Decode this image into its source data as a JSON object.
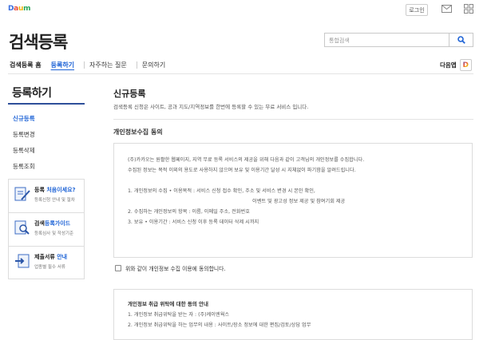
{
  "logo": "Daum",
  "topbar": {
    "login": "로그인"
  },
  "header": {
    "title": "검색등록",
    "search_placeholder": "통합검색"
  },
  "nav": {
    "home": "검색등록 홈",
    "active": "등록하기",
    "faq": "자주하는 질문",
    "contact": "문의하기",
    "right_label": "다음앱",
    "right_badge": "D"
  },
  "sidebar": {
    "title": "등록하기",
    "items": [
      {
        "label": "신규등록",
        "active": true
      },
      {
        "label": "등록변경"
      },
      {
        "label": "등록삭제"
      },
      {
        "label": "등록조회"
      }
    ],
    "promos": [
      {
        "title_plain": "등록 ",
        "title_hl": "처음이세요?",
        "sub": "등록신청 안내 및 절차",
        "icon": "pencil-doc-icon"
      },
      {
        "title_plain": "검색",
        "title_hl": "등록가이드",
        "sub": "등록심사 및 작성기준",
        "icon": "magnifier-doc-icon"
      },
      {
        "title_plain": "제출서류 ",
        "title_hl": "안내",
        "sub": "업종별 필수 서류",
        "icon": "arrow-doc-icon"
      }
    ]
  },
  "main": {
    "title": "신규등록",
    "desc": "검색등록 신청은 사이트, 공과 지도/지역정보를 한번에 등록할 수 있는 무료 서비스 입니다.",
    "section_title": "개인정보수집 동의",
    "agreement_lines": [
      "(주)카카오는 원활한 웹페이지, 지역 무료 등록 서비스의 제공을 위해 다음과 같이 고객님의 개인정보를 수집합니다.",
      "수집된 정보는 목적 이외의 용도로 사용하지 않으며 보유 및 이용기간 달성 시 지체없이 파기함을 알려드립니다.",
      "1. 개인정보의 수집 • 이용목적 : 서비스 신청 접수 확인, 주소 및 서비스 변경 시 본인 확인,",
      "이벤트 및 광고성 정보 제공 및 참여기회 제공",
      "2. 수집하는 개인정보의 항목 : 이름, 이메일 주소, 전화번호",
      "3. 보유 • 이용기간 : 서비스 신청 이후 등록 데이터 삭제 시까지"
    ],
    "agree_label": "위와 같이 개인정보 수집 이용에 동의합니다.",
    "notice_title": "개인정보 취급 위탁에 대한 동의 안내",
    "notice_lines": [
      "1. 개인정보 취급위탁을 받는 자 : (주)케이엔웍스",
      "2. 개인정보 취급위탁을 하는 업무의 내용 : 사이트/장소 정보에 대한 편집/검토/상담 업무"
    ]
  },
  "colors": {
    "accent": "#1e63d6",
    "sidebar_line": "#2e4f9a"
  }
}
